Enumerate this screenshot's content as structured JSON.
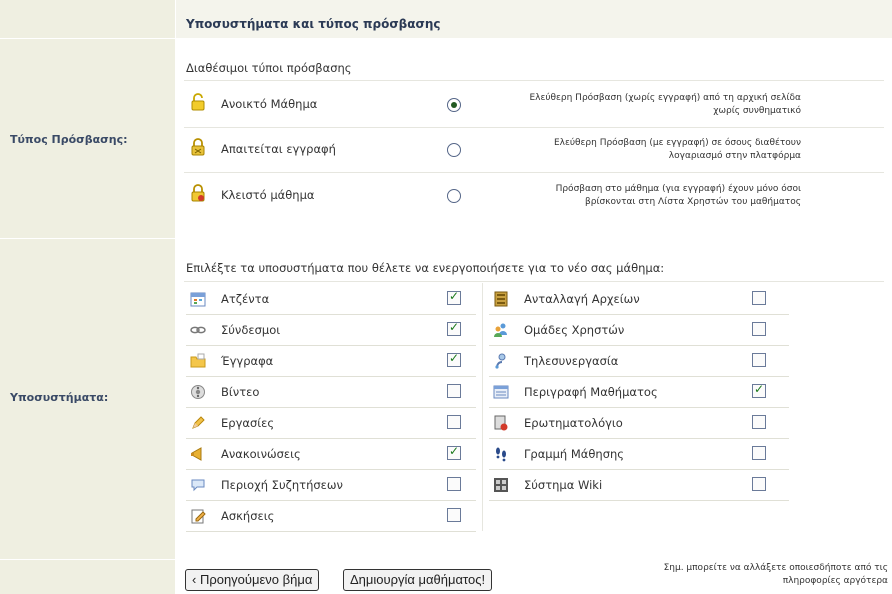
{
  "header": {
    "title": "Υποσυστήματα και τύπος πρόσβασης"
  },
  "access": {
    "label": "Τύπος Πρόσβασης:",
    "subheading": "Διαθέσιμοι τύποι πρόσβασης",
    "options": [
      {
        "label": "Ανοικτό Μάθημα",
        "icon": "unlock-icon",
        "selected": true,
        "desc1": "Ελεύθερη Πρόσβαση (χωρίς εγγραφή) από τη αρχική σελίδα",
        "desc2": "χωρίς συνθηματικό"
      },
      {
        "label": "Απαιτείται εγγραφή",
        "icon": "registration-lock-icon",
        "selected": false,
        "desc1": "Ελεύθερη Πρόσβαση (με εγγραφή) σε όσους διαθέτουν",
        "desc2": "λογαριασμό στην πλατφόρμα"
      },
      {
        "label": "Κλειστό μάθημα",
        "icon": "closed-lock-icon",
        "selected": false,
        "desc1": "Πρόσβαση στο μάθημα (για εγγραφή) έχουν μόνο όσοι",
        "desc2": "βρίσκονται στη Λίστα Χρηστών του μαθήματος"
      }
    ]
  },
  "modules": {
    "label": "Υποσυστήματα:",
    "subheading": "Επιλέξτε τα υποσυστήματα που θέλετε να ενεργοποιήσετε για το νέο σας μάθημα:",
    "left": [
      {
        "label": "Ατζέντα",
        "icon": "calendar-icon",
        "checked": true
      },
      {
        "label": "Σύνδεσμοι",
        "icon": "link-icon",
        "checked": true
      },
      {
        "label": "Έγγραφα",
        "icon": "folder-icon",
        "checked": true
      },
      {
        "label": "Βίντεο",
        "icon": "video-icon",
        "checked": false
      },
      {
        "label": "Εργασίες",
        "icon": "pencil-icon",
        "checked": false
      },
      {
        "label": "Ανακοινώσεις",
        "icon": "megaphone-icon",
        "checked": true
      },
      {
        "label": "Περιοχή Συζητήσεων",
        "icon": "speech-bubble-icon",
        "checked": false
      },
      {
        "label": "Ασκήσεις",
        "icon": "exercise-icon",
        "checked": false
      }
    ],
    "right": [
      {
        "label": "Ανταλλαγή Αρχείων",
        "icon": "file-exchange-icon",
        "checked": false
      },
      {
        "label": "Ομάδες Χρηστών",
        "icon": "user-groups-icon",
        "checked": false
      },
      {
        "label": "Τηλεσυνεργασία",
        "icon": "teleconference-icon",
        "checked": false
      },
      {
        "label": "Περιγραφή Μαθήματος",
        "icon": "course-description-icon",
        "checked": true
      },
      {
        "label": "Ερωτηματολόγιο",
        "icon": "questionnaire-icon",
        "checked": false
      },
      {
        "label": "Γραμμή Μάθησης",
        "icon": "footsteps-icon",
        "checked": false
      },
      {
        "label": "Σύστημα Wiki",
        "icon": "wiki-icon",
        "checked": false
      }
    ]
  },
  "footer": {
    "prev_button": "‹ Προηγούμενο βήμα",
    "create_button": "Δημιουργία μαθήματος!",
    "note1": "Σημ. μπορείτε να αλλάξετε οποιεσδήποτε από τις",
    "note2": "πληροφορίες αργότερα"
  }
}
